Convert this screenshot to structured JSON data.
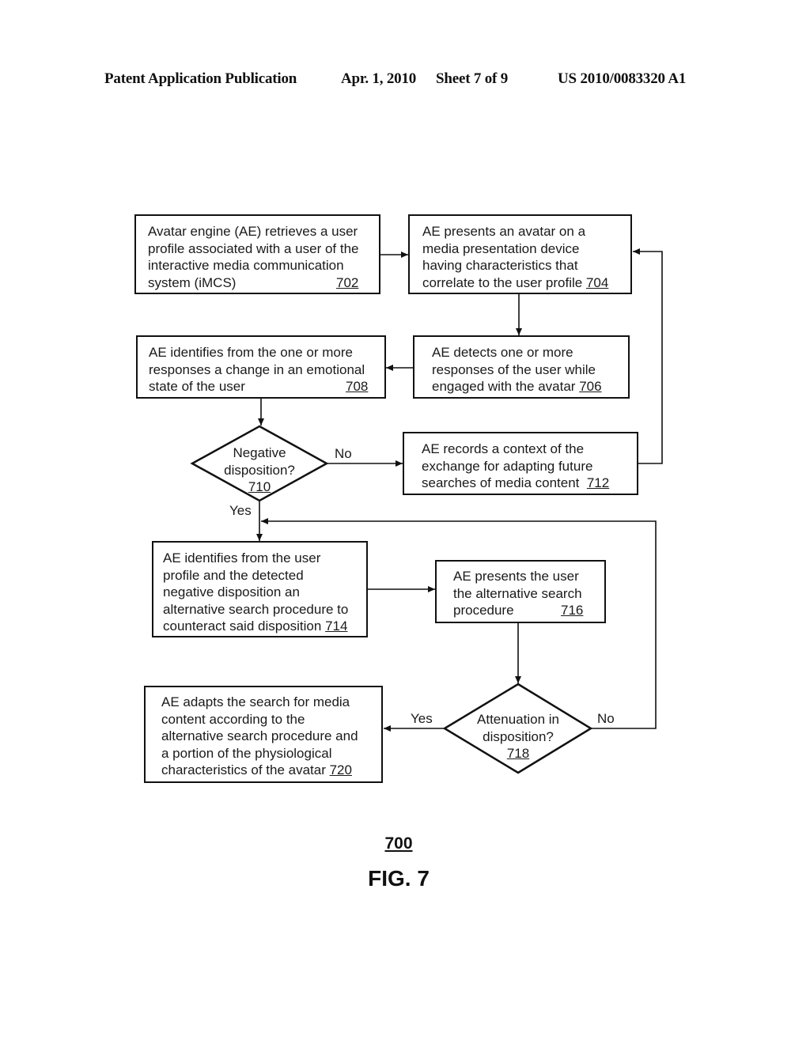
{
  "header": {
    "left": "Patent Application Publication",
    "date": "Apr. 1, 2010",
    "sheet": "Sheet 7 of 9",
    "pub_number": "US 2010/0083320 A1"
  },
  "steps": {
    "s702": {
      "lines": [
        "Avatar engine (AE) retrieves a user",
        "profile associated with a user of the",
        "interactive media communication",
        "system (iMCS)"
      ],
      "ref": "702"
    },
    "s704": {
      "lines": [
        "AE presents an avatar on a",
        "media presentation device",
        "having characteristics that",
        "correlate to the user profile "
      ],
      "ref": "704"
    },
    "s706": {
      "lines": [
        "AE detects one or more",
        "responses of the user while",
        "engaged with the avatar "
      ],
      "ref": "706"
    },
    "s708": {
      "lines": [
        "AE identifies from the one or more",
        "responses a change in an emotional",
        "state of the user"
      ],
      "ref": "708"
    },
    "s710": {
      "lines": [
        "Negative",
        "disposition?"
      ],
      "ref": "710"
    },
    "s712": {
      "lines": [
        "AE records a context of the",
        "exchange for adapting future",
        "searches of media content  "
      ],
      "ref": "712"
    },
    "s714": {
      "lines": [
        "AE identifies from the user",
        "profile and the detected",
        "negative disposition an",
        "alternative search procedure to",
        "counteract said disposition "
      ],
      "ref": "714"
    },
    "s716": {
      "lines": [
        "AE presents the user",
        "the alternative search",
        "procedure"
      ],
      "ref": "716"
    },
    "s718": {
      "lines": [
        "Attenuation in",
        "disposition?"
      ],
      "ref": "718"
    },
    "s720": {
      "lines": [
        "AE adapts the search for media",
        "content according to the",
        "alternative search procedure and",
        "a portion of the physiological",
        "characteristics of the avatar "
      ],
      "ref": "720"
    }
  },
  "labels": {
    "d710_no": "No",
    "d710_yes": "Yes",
    "d718_yes": "Yes",
    "d718_no": "No"
  },
  "figure": {
    "number": "700",
    "caption": "FIG. 7"
  }
}
